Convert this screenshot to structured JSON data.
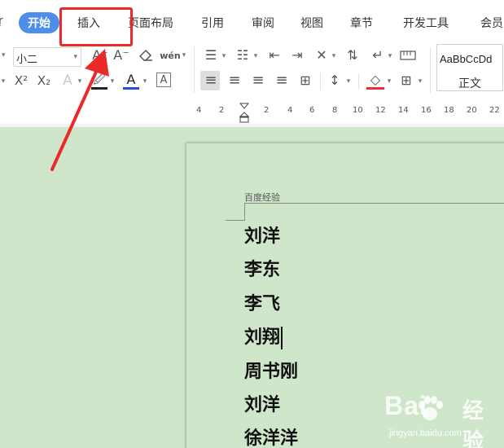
{
  "tabs": {
    "cut_left": "ŗ",
    "home": "开始",
    "insert": "插入",
    "layout": "页面布局",
    "reference": "引用",
    "review": "审阅",
    "view": "视图",
    "chapter": "章节",
    "devtools": "开发工具",
    "member": "会员"
  },
  "ribbon": {
    "font_size_value": "小二",
    "grow_font_glyph": "A⁺",
    "shrink_font_glyph": "A⁻",
    "clear_format_glyph": "⌫",
    "phonetic_glyph": "wén",
    "superscript_glyph": "X²",
    "subscript_glyph": "X₂",
    "text_effect_glyph": "A",
    "highlight_glyph": "🖉",
    "font_color_glyph": "A",
    "char_border_glyph": "A",
    "bullets_glyph": "☰",
    "numbering_glyph": "☷",
    "outdent_glyph": "⇤",
    "indent_glyph": "⇥",
    "chinese_layout_glyph": "✕",
    "sort_glyph": "⇅",
    "show_marks_glyph": "↵",
    "align_left_glyph": "≡",
    "align_center_glyph": "≡",
    "align_right_glyph": "≡",
    "justify_glyph": "≡",
    "distribute_glyph": "⊞",
    "line_spacing_glyph": "↕",
    "shading_glyph": "◇",
    "borders_glyph": "⊞",
    "style_preview": "AaBbCcDd",
    "style_name": "正文"
  },
  "ruler": {
    "ticks": [
      "4",
      "2",
      "2",
      "4",
      "6",
      "8",
      "10",
      "12",
      "14",
      "16",
      "18",
      "20",
      "22"
    ]
  },
  "document": {
    "header_text": "百度经验",
    "names": [
      "刘洋",
      "李东",
      "李飞",
      "刘翔",
      "周书刚",
      "刘洋",
      "徐洋洋"
    ]
  },
  "watermark": {
    "brand": "Bai",
    "brand_cn": "经验",
    "url": "jingyan.baidu.com"
  },
  "colors": {
    "accent_blue": "#4d8fe8",
    "annotation_red": "#ea2a2a",
    "page_green": "#cfe6cb"
  }
}
